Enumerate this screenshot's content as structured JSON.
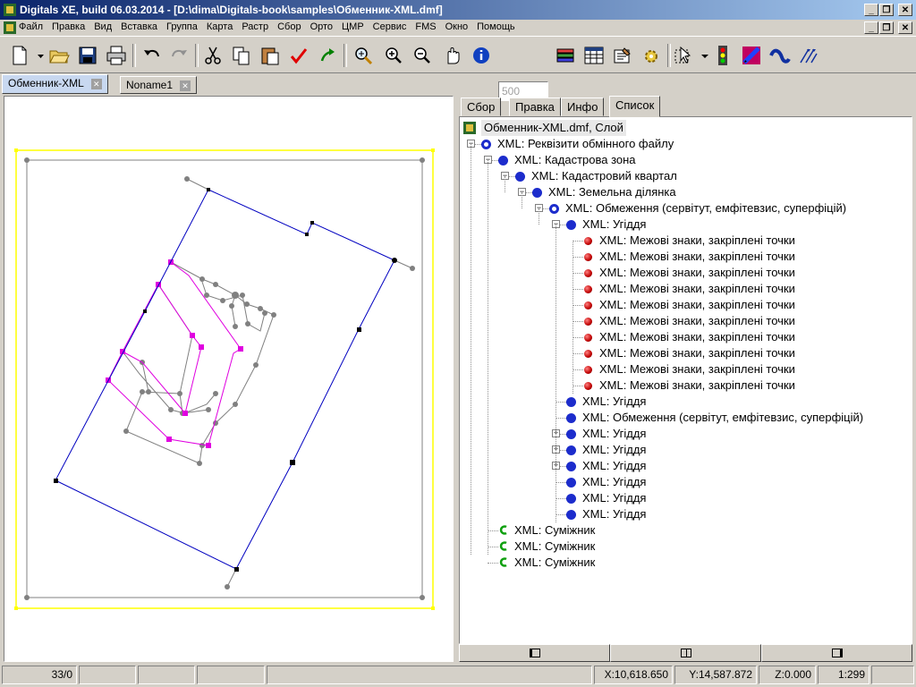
{
  "window": {
    "title": "Digitals XE, build 06.03.2014 - [D:\\dima\\Digitals-book\\samples\\Обменник-XML.dmf]"
  },
  "menu": {
    "items": [
      "Файл",
      "Правка",
      "Вид",
      "Вставка",
      "Группа",
      "Карта",
      "Растр",
      "Сбор",
      "Орто",
      "ЦМР",
      "Сервис",
      "FMS",
      "Окно",
      "Помощь"
    ]
  },
  "toolbar": {
    "zoom_value": "500",
    "buttons": [
      "new-icon",
      "open-icon",
      "save-icon",
      "print-icon",
      "undo-icon",
      "redo-icon",
      "cut-icon",
      "copy-icon",
      "paste-icon",
      "check-icon",
      "arrow-icon",
      "zoom-tool-icon",
      "zoom-in-icon",
      "zoom-out-icon",
      "pan-hand-icon",
      "info-icon",
      "layers-icon",
      "table-icon",
      "folder-edit-icon",
      "gear-icon",
      "select-icon",
      "traffic-light-icon",
      "pen-icon",
      "curve-icon",
      "arrows-icon"
    ]
  },
  "doc_tabs": [
    {
      "label": "Обменник-XML",
      "active": true
    },
    {
      "label": "Noname1",
      "active": false
    }
  ],
  "panel_tabs": [
    {
      "label": "Сбор",
      "active": false
    },
    {
      "label": "Правка",
      "active": false
    },
    {
      "label": "Инфо",
      "active": false
    },
    {
      "label": "Список",
      "active": true
    }
  ],
  "tree": {
    "root": "Обменник-XML.dmf, Слой",
    "nodes": [
      {
        "label": "XML: Реквізити обмінного файлу",
        "expander": "−",
        "icon": "ring"
      },
      {
        "label": "XML: Кадастрова зона",
        "expander": "−",
        "icon": "dot"
      },
      {
        "label": "XML: Кадастровий квартал",
        "expander": "−",
        "icon": "dot"
      },
      {
        "label": "XML: Земельна ділянка",
        "expander": "−",
        "icon": "dot"
      },
      {
        "label": "XML: Обмеження (сервітут, емфітевзис, суперфіцій)",
        "expander": "−",
        "icon": "ring"
      },
      {
        "label": "XML: Угіддя",
        "expander": "−",
        "icon": "dot"
      },
      {
        "label": "XML: Межові знаки, закріплені точки",
        "expander": "",
        "icon": "small"
      },
      {
        "label": "XML: Межові знаки, закріплені точки",
        "expander": "",
        "icon": "small"
      },
      {
        "label": "XML: Межові знаки, закріплені точки",
        "expander": "",
        "icon": "small"
      },
      {
        "label": "XML: Межові знаки, закріплені точки",
        "expander": "",
        "icon": "small"
      },
      {
        "label": "XML: Межові знаки, закріплені точки",
        "expander": "",
        "icon": "small"
      },
      {
        "label": "XML: Межові знаки, закріплені точки",
        "expander": "",
        "icon": "small"
      },
      {
        "label": "XML: Межові знаки, закріплені точки",
        "expander": "",
        "icon": "small"
      },
      {
        "label": "XML: Межові знаки, закріплені точки",
        "expander": "",
        "icon": "small"
      },
      {
        "label": "XML: Межові знаки, закріплені точки",
        "expander": "",
        "icon": "small"
      },
      {
        "label": "XML: Межові знаки, закріплені точки",
        "expander": "",
        "icon": "small"
      },
      {
        "label": "XML: Угіддя",
        "expander": "",
        "icon": "dot"
      },
      {
        "label": "XML: Обмеження (сервітут, емфітевзис, суперфіцій)",
        "expander": "",
        "icon": "dot"
      },
      {
        "label": "XML: Угіддя",
        "expander": "+",
        "icon": "dot"
      },
      {
        "label": "XML: Угіддя",
        "expander": "+",
        "icon": "dot"
      },
      {
        "label": "XML: Угіддя",
        "expander": "+",
        "icon": "dot"
      },
      {
        "label": "XML: Угіддя",
        "expander": "",
        "icon": "dot"
      },
      {
        "label": "XML: Угіддя",
        "expander": "",
        "icon": "dot"
      },
      {
        "label": "XML: Угіддя",
        "expander": "",
        "icon": "dot"
      },
      {
        "label": "XML: Суміжник",
        "expander": "",
        "icon": "hook"
      },
      {
        "label": "XML: Суміжник",
        "expander": "",
        "icon": "hook"
      },
      {
        "label": "XML: Суміжник",
        "expander": "",
        "icon": "hook"
      }
    ]
  },
  "status": {
    "count": "33/0",
    "x": "X:10,618.650",
    "y": "Y:14,587.872",
    "z": "Z:0.000",
    "scale": "1:299"
  },
  "colors": {
    "parcel": "#0000c0",
    "landuse": "#e000e0",
    "adjacent": "#808080",
    "frame": "#ffff00"
  }
}
